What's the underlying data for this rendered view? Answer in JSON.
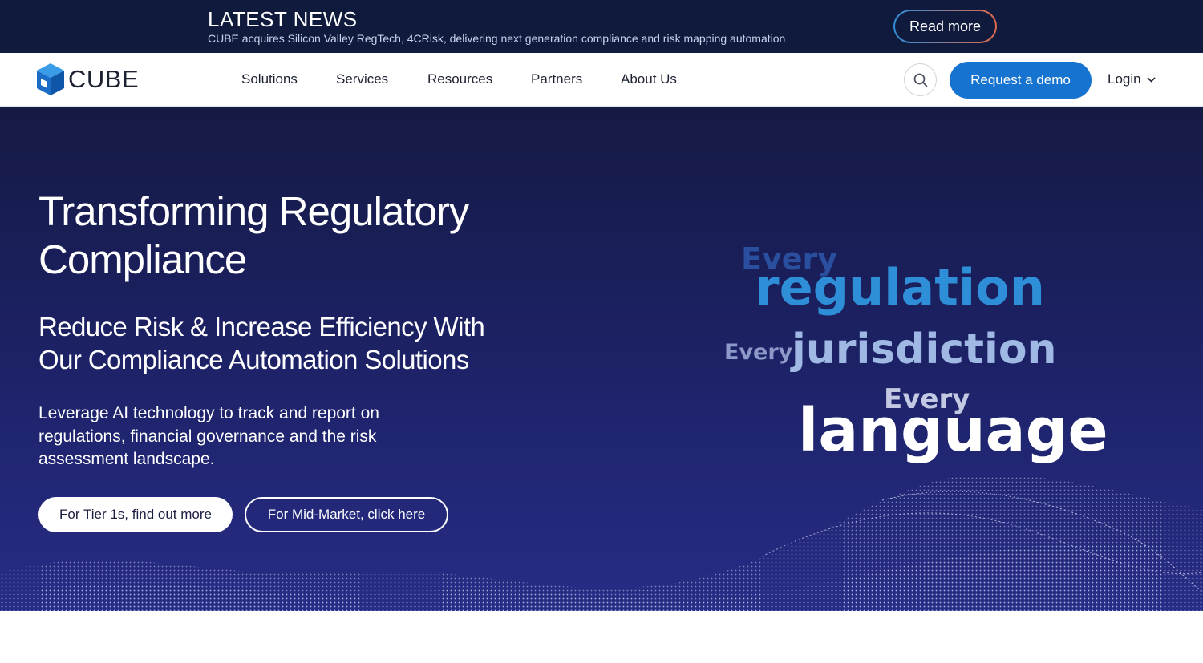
{
  "news": {
    "title": "LATEST NEWS",
    "text": "CUBE acquires Silicon Valley RegTech, 4CRisk, delivering next generation compliance and risk mapping automation",
    "read_more": "Read more"
  },
  "nav": {
    "logo_text": "CUBE",
    "items": [
      "Solutions",
      "Services",
      "Resources",
      "Partners",
      "About Us"
    ],
    "search_icon": "search-icon",
    "demo_label": "Request a demo",
    "login_label": "Login"
  },
  "hero": {
    "title_line1": "Transforming Regulatory",
    "title_line2": "Compliance",
    "subtitle_line1": "Reduce Risk & Increase Efficiency With",
    "subtitle_line2": "Our Compliance Automation Solutions",
    "desc_line1": "Leverage AI technology to track and report on",
    "desc_line2": "regulations, financial governance and the risk",
    "desc_line3": "assessment landscape.",
    "btn_tier1": "For Tier 1s, find out more",
    "btn_midmarket": "For Mid-Market, click here",
    "words": {
      "every1": "Every",
      "regulation": "regulation",
      "every2": "Every",
      "jurisdiction": "jurisdiction",
      "every3": "Every",
      "language": "language"
    }
  },
  "colors": {
    "news_bg": "#0f1a3c",
    "accent_blue": "#1673cf",
    "hero_bg": "#1c2163"
  }
}
